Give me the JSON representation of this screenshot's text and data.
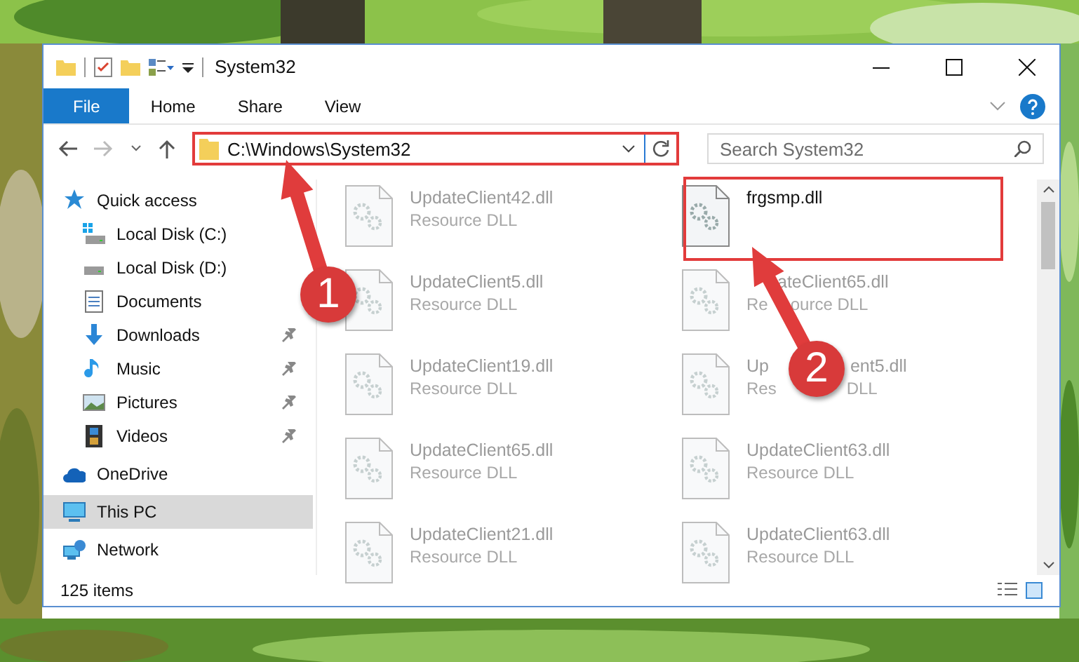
{
  "window": {
    "title": "System32"
  },
  "ribbon_tabs": [
    {
      "label": "File",
      "kind": "file"
    },
    {
      "label": "Home",
      "kind": "tab"
    },
    {
      "label": "Share",
      "kind": "tab"
    },
    {
      "label": "View",
      "kind": "tab"
    }
  ],
  "address_bar": {
    "path": "C:\\Windows\\System32"
  },
  "search": {
    "placeholder": "Search System32"
  },
  "sidebar": {
    "items": [
      {
        "label": "Quick access",
        "kind": "star",
        "selected": false,
        "children": [
          {
            "label": "Local Disk (C:)",
            "kind": "windrive",
            "selected": false
          },
          {
            "label": "Local Disk (D:)",
            "kind": "drive",
            "selected": false
          },
          {
            "label": "Documents",
            "kind": "document",
            "selected": false
          },
          {
            "label": "Downloads",
            "kind": "download",
            "pinned": true,
            "selected": false
          },
          {
            "label": "Music",
            "kind": "music",
            "pinned": true,
            "selected": false
          },
          {
            "label": "Pictures",
            "kind": "pictures",
            "pinned": true,
            "selected": false
          },
          {
            "label": "Videos",
            "kind": "videos",
            "pinned": true,
            "selected": false
          }
        ]
      },
      {
        "label": "OneDrive",
        "kind": "cloud",
        "selected": false
      },
      {
        "label": "This PC",
        "kind": "pc",
        "selected": true
      },
      {
        "label": "Network",
        "kind": "network",
        "selected": false
      }
    ]
  },
  "files": [
    {
      "name_parts": [
        "UpdateClient42.dll"
      ],
      "type_parts": [
        "Resource DLL"
      ],
      "blurred": true
    },
    {
      "name_parts": [
        "frgsmp.dll"
      ],
      "blurred": false
    },
    {
      "name_parts": [
        "UpdateClient5.dll"
      ],
      "type_parts": [
        "Resource DLL"
      ],
      "blurred": true
    },
    {
      "name_parts": [
        "ateClient65.dll"
      ],
      "type_parts": [
        "Re",
        "ource DLL"
      ],
      "blurred": true
    },
    {
      "name_parts": [
        "UpdateClient19.dll"
      ],
      "type_parts": [
        "Resource DLL"
      ],
      "blurred": true
    },
    {
      "name_parts": [
        "Up",
        "ent5.dll"
      ],
      "type_parts": [
        "Res",
        "DLL"
      ],
      "blurred": true
    },
    {
      "name_parts": [
        "UpdateClient65.dll"
      ],
      "type_parts": [
        "Resource DLL"
      ],
      "blurred": true
    },
    {
      "name_parts": [
        "UpdateClient63.dll"
      ],
      "type_parts": [
        "Resource DLL"
      ],
      "blurred": true
    },
    {
      "name_parts": [
        "UpdateClient21.dll"
      ],
      "type_parts": [
        "Resource DLL"
      ],
      "blurred": true
    },
    {
      "name_parts": [
        "UpdateClient63.dll"
      ],
      "type_parts": [
        "Resource DLL"
      ],
      "blurred": true
    }
  ],
  "status_bar": {
    "item_count": "125 items"
  },
  "callouts": [
    {
      "label": "1"
    },
    {
      "label": "2"
    }
  ]
}
